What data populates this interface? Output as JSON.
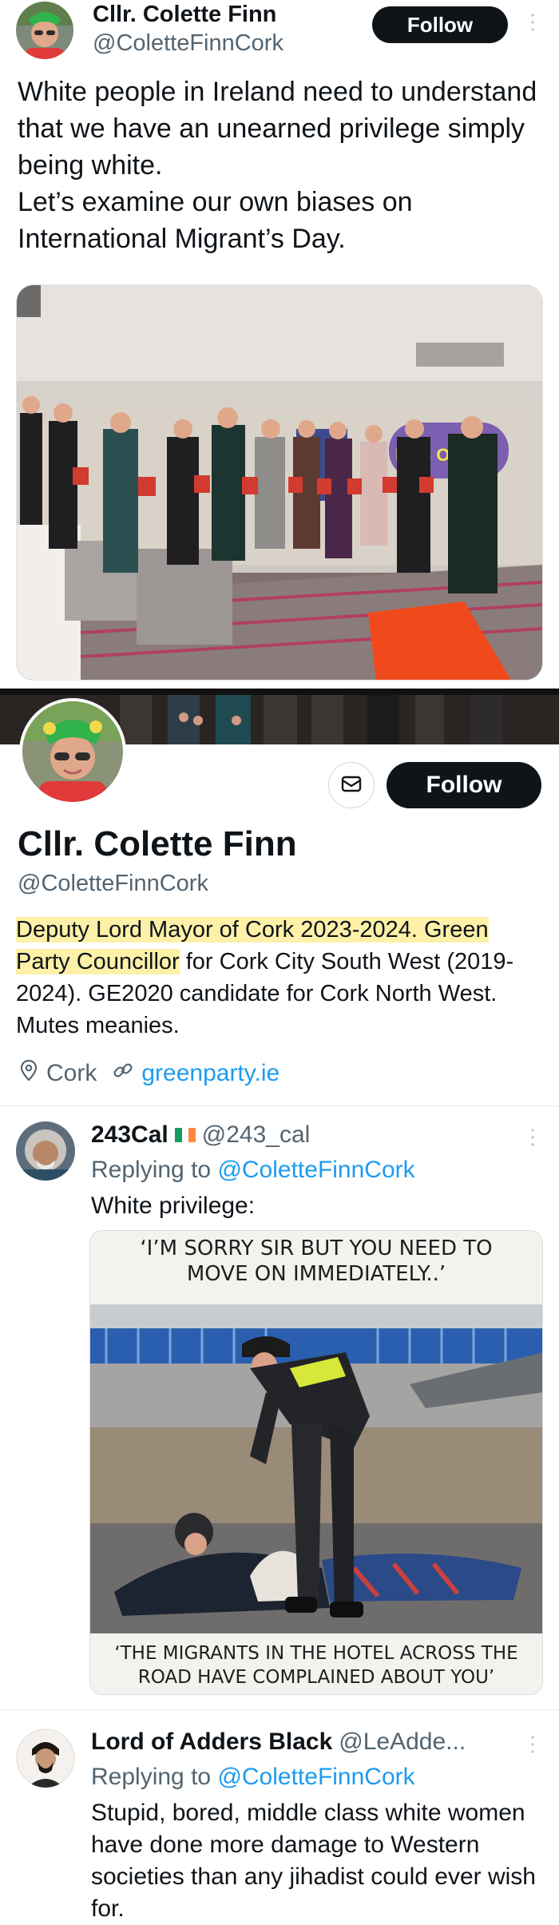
{
  "tweet": {
    "author_name": "Cllr. Colette Finn",
    "author_handle": "@ColetteFinnCork",
    "follow_label": "Follow",
    "text": "White people in Ireland need to understand that we have an unearned privilege simply being white.\nLet’s examine our own biases on International Migrant’s Day.",
    "banner_text": "ERS OMA"
  },
  "profile": {
    "name": "Cllr. Colette Finn",
    "handle": "@ColetteFinnCork",
    "follow_label": "Follow",
    "bio_highlight": "Deputy Lord Mayor of Cork 2023-2024. Green Party Councillor",
    "bio_rest": " for Cork City South West (2019-2024). GE2020 candidate for Cork North West. Mutes meanies.",
    "location": "Cork",
    "website": "greenparty.ie",
    "highlight_color": "#fdf0a8"
  },
  "replies": [
    {
      "author_name": "243Cal",
      "flag": "🇮🇪",
      "author_handle": "@243_cal",
      "replying_prefix": "Replying to",
      "replying_to": "@ColetteFinnCork",
      "text": "White privilege:",
      "meme_top": "‘I’M SORRY SIR BUT YOU NEED TO MOVE ON IMMEDIATELY..’",
      "meme_bottom": "‘THE MIGRANTS IN THE HOTEL ACROSS THE ROAD HAVE COMPLAINED ABOUT YOU’"
    },
    {
      "author_name": "Lord of Adders Black",
      "author_handle": "@LeAdde...",
      "replying_prefix": "Replying to",
      "replying_to": "@ColetteFinnCork",
      "text": "Stupid, bored, middle class white women have done more damage to Western societies than any jihadist could ever wish for."
    }
  ],
  "colors": {
    "accent": "#1d9bf0",
    "button": "#0f1419",
    "secondary_text": "#536471"
  }
}
